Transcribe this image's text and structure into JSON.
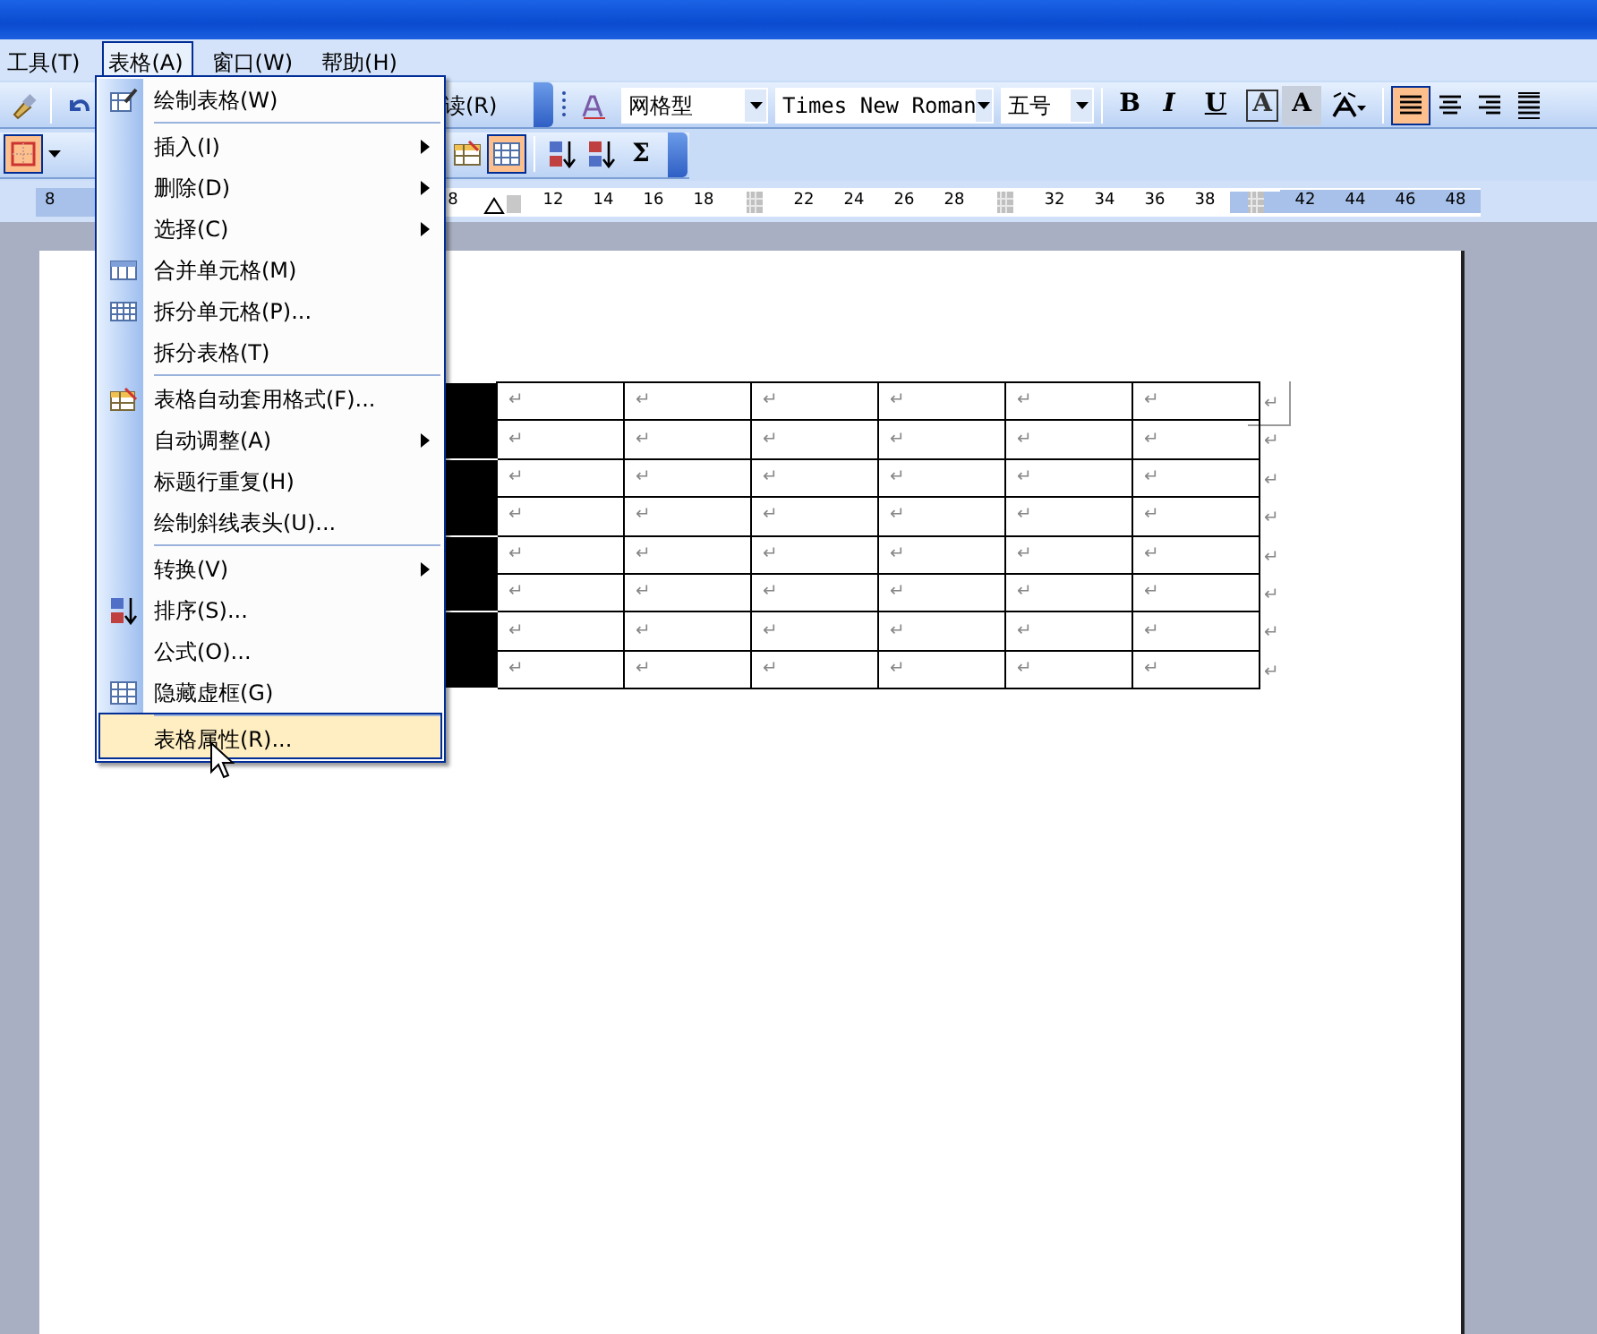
{
  "menu_bar": [
    {
      "label": "工具(T)",
      "selected": false
    },
    {
      "label": "表格(A)",
      "selected": true
    },
    {
      "label": "窗口(W)",
      "selected": false
    },
    {
      "label": "帮助(H)",
      "selected": false
    }
  ],
  "formatting_toolbar": {
    "read_label": "读(R)",
    "style": "网格型",
    "font": "Times New Roman",
    "size": "五号",
    "text_buttons": [
      {
        "label": "B",
        "kind": "bold"
      },
      {
        "label": "I",
        "kind": "italic"
      },
      {
        "label": "U",
        "kind": "underline"
      },
      {
        "label": "A",
        "kind": "boxed"
      },
      {
        "label": "A",
        "kind": "shaded"
      }
    ],
    "align_buttons": [
      {
        "selected": true
      },
      {
        "selected": false
      },
      {
        "selected": false
      },
      {
        "selected": false
      }
    ]
  },
  "tables_toolbar": {
    "border_selected": true,
    "tools": [
      {
        "selected": false
      },
      {
        "selected": true
      },
      {
        "selected": false
      },
      {
        "selected": false
      },
      {
        "label": "Σ",
        "selected": false
      }
    ]
  },
  "ruler": {
    "left_label": "8",
    "marks": [
      {
        "kind": "number",
        "text": "8"
      },
      {
        "kind": "indent"
      },
      {
        "kind": "number",
        "text": "12"
      },
      {
        "kind": "number",
        "text": "14"
      },
      {
        "kind": "number",
        "text": "16"
      },
      {
        "kind": "number",
        "text": "18"
      },
      {
        "kind": "column"
      },
      {
        "kind": "number",
        "text": "22"
      },
      {
        "kind": "number",
        "text": "24"
      },
      {
        "kind": "number",
        "text": "26"
      },
      {
        "kind": "number",
        "text": "28"
      },
      {
        "kind": "column"
      },
      {
        "kind": "number",
        "text": "32"
      },
      {
        "kind": "number",
        "text": "34"
      },
      {
        "kind": "number",
        "text": "36"
      },
      {
        "kind": "number",
        "text": "38"
      },
      {
        "kind": "column"
      },
      {
        "kind": "number",
        "text": "42"
      },
      {
        "kind": "number",
        "text": "44"
      },
      {
        "kind": "number",
        "text": "46"
      },
      {
        "kind": "number",
        "text": "48"
      }
    ]
  },
  "table_menu": [
    {
      "label": "绘制表格(W)",
      "submenu": false,
      "separator_before": false,
      "highlighted": false
    },
    {
      "label": "插入(I)",
      "submenu": true,
      "separator_before": true,
      "highlighted": false
    },
    {
      "label": "删除(D)",
      "submenu": true,
      "separator_before": false,
      "highlighted": false
    },
    {
      "label": "选择(C)",
      "submenu": true,
      "separator_before": false,
      "highlighted": false
    },
    {
      "label": "合并单元格(M)",
      "submenu": false,
      "separator_before": false,
      "highlighted": false
    },
    {
      "label": "拆分单元格(P)...",
      "submenu": false,
      "separator_before": false,
      "highlighted": false
    },
    {
      "label": "拆分表格(T)",
      "submenu": false,
      "separator_before": false,
      "highlighted": false
    },
    {
      "label": "表格自动套用格式(F)...",
      "submenu": false,
      "separator_before": true,
      "highlighted": false
    },
    {
      "label": "自动调整(A)",
      "submenu": true,
      "separator_before": false,
      "highlighted": false
    },
    {
      "label": "标题行重复(H)",
      "submenu": false,
      "separator_before": false,
      "highlighted": false
    },
    {
      "label": "绘制斜线表头(U)...",
      "submenu": false,
      "separator_before": false,
      "highlighted": false
    },
    {
      "label": "转换(V)",
      "submenu": true,
      "separator_before": true,
      "highlighted": false
    },
    {
      "label": "排序(S)...",
      "submenu": false,
      "separator_before": false,
      "highlighted": false
    },
    {
      "label": "公式(O)...",
      "submenu": false,
      "separator_before": false,
      "highlighted": false
    },
    {
      "label": "隐藏虚框(G)",
      "submenu": false,
      "separator_before": false,
      "highlighted": false
    },
    {
      "label": "表格属性(R)...",
      "submenu": false,
      "separator_before": true,
      "highlighted": true
    }
  ],
  "table": {
    "first_column": [
      {
        "selected": true
      },
      {
        "selected": true
      },
      {
        "selected": true
      },
      {
        "selected": true
      }
    ],
    "rows": [
      {
        "cells": [
          "↵",
          "↵",
          "↵",
          "↵",
          "↵",
          "↵"
        ],
        "end_mark": "↵"
      },
      {
        "cells": [
          "↵",
          "↵",
          "↵",
          "↵",
          "↵",
          "↵"
        ],
        "end_mark": "↵"
      },
      {
        "cells": [
          "↵",
          "↵",
          "↵",
          "↵",
          "↵",
          "↵"
        ],
        "end_mark": "↵"
      },
      {
        "cells": [
          "↵",
          "↵",
          "↵",
          "↵",
          "↵",
          "↵"
        ],
        "end_mark": "↵"
      },
      {
        "cells": [
          "↵",
          "↵",
          "↵",
          "↵",
          "↵",
          "↵"
        ],
        "end_mark": "↵"
      },
      {
        "cells": [
          "↵",
          "↵",
          "↵",
          "↵",
          "↵",
          "↵"
        ],
        "end_mark": "↵"
      },
      {
        "cells": [
          "↵",
          "↵",
          "↵",
          "↵",
          "↵",
          "↵"
        ],
        "end_mark": "↵"
      },
      {
        "cells": [
          "↵",
          "↵",
          "↵",
          "↵",
          "↵",
          "↵"
        ],
        "end_mark": "↵"
      }
    ]
  }
}
